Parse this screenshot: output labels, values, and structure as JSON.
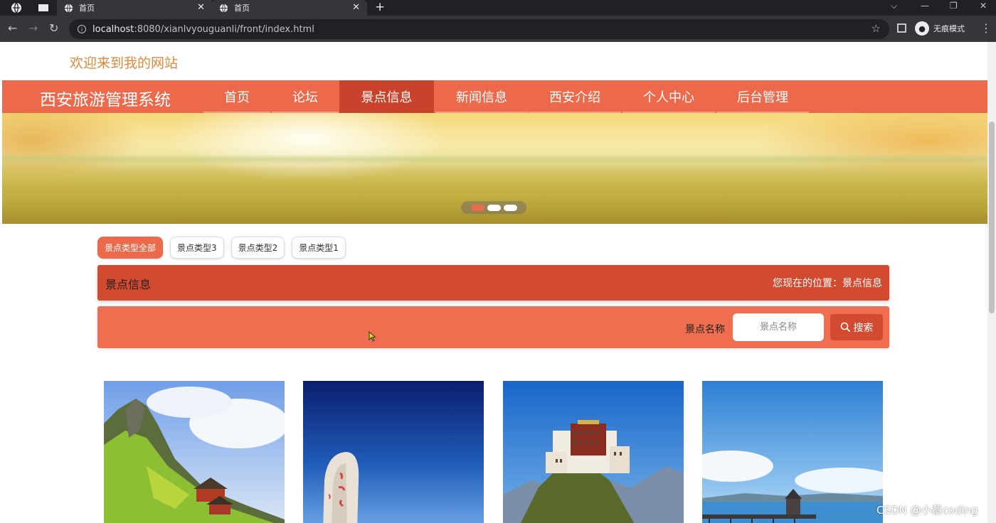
{
  "browser": {
    "tabs": [
      {
        "title": "首页"
      },
      {
        "title": "首页"
      }
    ],
    "url_host": "localhost",
    "url_rest": ":8080/xianlvyouguanli/front/index.html",
    "incognito_label": "无痕模式"
  },
  "page": {
    "welcome": "欢迎来到我的网站",
    "site_title": "西安旅游管理系统",
    "nav": [
      {
        "label": "首页",
        "active": false
      },
      {
        "label": "论坛",
        "active": false
      },
      {
        "label": "景点信息",
        "active": true
      },
      {
        "label": "新闻信息",
        "active": false
      },
      {
        "label": "西安介绍",
        "active": false
      },
      {
        "label": "个人中心",
        "active": false
      },
      {
        "label": "后台管理",
        "active": false
      }
    ],
    "carousel": {
      "slides": 3,
      "active_index": 0
    },
    "filters": [
      {
        "label": "景点类型全部",
        "active": true
      },
      {
        "label": "景点类型3",
        "active": false
      },
      {
        "label": "景点类型2",
        "active": false
      },
      {
        "label": "景点类型1",
        "active": false
      }
    ],
    "section_title": "景点信息",
    "location_label": "您现在的位置：",
    "location_value": "景点信息",
    "search": {
      "label": "景点名称",
      "placeholder": "景点名称",
      "button": "搜索"
    },
    "cards": [
      {
        "image": "mountain-temple"
      },
      {
        "image": "stone-monument"
      },
      {
        "image": "potala-palace"
      },
      {
        "image": "lake-pier"
      }
    ]
  },
  "watermark": "CSDN @小蔡coding",
  "colors": {
    "accent": "#ec6a4b",
    "accent_dark": "#d24b30",
    "welcome_text": "#e0893a"
  }
}
